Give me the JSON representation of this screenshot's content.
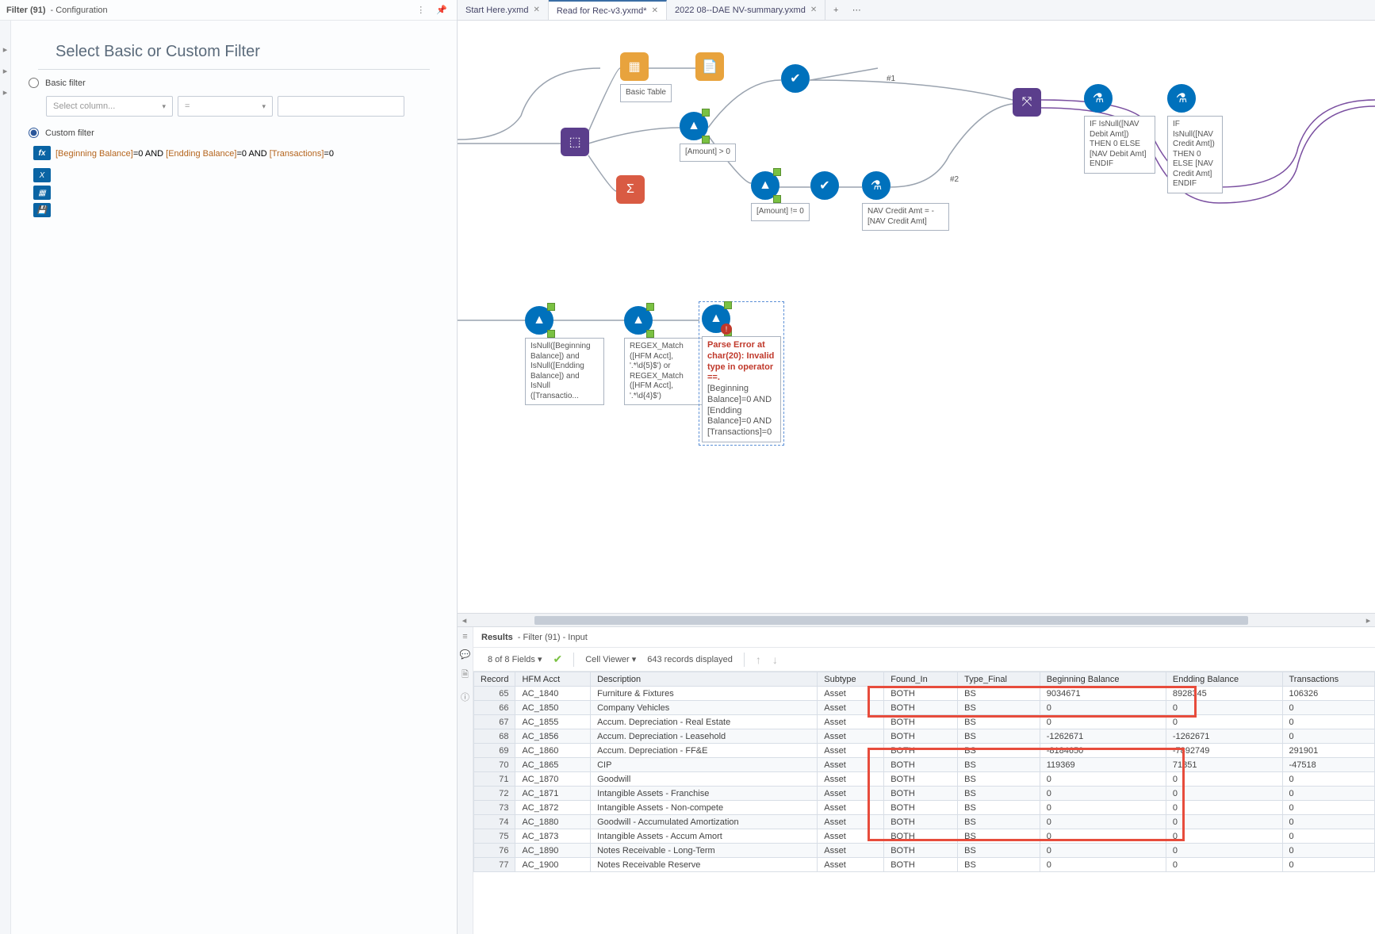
{
  "tabs": [
    {
      "label": "Start Here.yxmd"
    },
    {
      "label": "Read for Rec-v3.yxmd*"
    },
    {
      "label": "2022 08--DAE NV-summary.yxmd"
    }
  ],
  "config": {
    "header_title": "Filter (91)",
    "header_sub": "- Configuration",
    "panel_title": "Select Basic or Custom Filter",
    "basic_label": "Basic filter",
    "custom_label": "Custom filter",
    "select_column_ph": "Select column...",
    "operator_ph": "=",
    "expr_field1": "[Beginning Balance]",
    "expr_op1": "=",
    "expr_v1": "0 AND ",
    "expr_field2": "[Endding Balance]",
    "expr_v2": "=0 AND ",
    "expr_field3": "[Transactions]",
    "expr_v3": "=0"
  },
  "canvas": {
    "basic_table": "Basic Table",
    "amount_gt": "[Amount] > 0",
    "amount_ne": "[Amount] != 0",
    "nav_credit": "NAV Credit Amt = -[NAV Credit Amt]",
    "isnull_label": "IsNull([Beginning Balance]) and IsNull([Endding Balance]) and IsNull ([Transactio...",
    "regex_label": "REGEX_Match ([HFM Acct], '.*\\d{5}$') or REGEX_Match ([HFM Acct], '.*\\d{4}$')",
    "error_head": "Parse Error at char(20): Invalid type in operator ==.",
    "error_body": "[Beginning Balance]=0 AND [Endding Balance]=0 AND [Transactions]=0",
    "formula1": "IF IsNull([NAV Debit Amt]) THEN 0 ELSE [NAV Debit Amt] ENDIF",
    "formula2": "IF IsNull([NAV Credit Amt]) THEN 0 ELSE [NAV Credit Amt] ENDIF",
    "anno1": "#1",
    "anno2": "#2"
  },
  "results": {
    "header_title": "Results",
    "header_sub": "- Filter (91) - Input",
    "fields": "8 of 8 Fields",
    "cellviewer": "Cell Viewer",
    "records": "643 records displayed",
    "cols": [
      "Record",
      "HFM Acct",
      "Description",
      "Subtype",
      "Found_In",
      "Type_Final",
      "Beginning Balance",
      "Endding Balance",
      "Transactions"
    ],
    "rows": [
      [
        "65",
        "AC_1840",
        "Furniture & Fixtures",
        "Asset",
        "BOTH",
        "BS",
        "9034671",
        "8928345",
        "106326"
      ],
      [
        "66",
        "AC_1850",
        "Company Vehicles",
        "Asset",
        "BOTH",
        "BS",
        "0",
        "0",
        "0"
      ],
      [
        "67",
        "AC_1855",
        "Accum. Depreciation - Real Estate",
        "Asset",
        "BOTH",
        "BS",
        "0",
        "0",
        "0"
      ],
      [
        "68",
        "AC_1856",
        "Accum. Depreciation - Leasehold",
        "Asset",
        "BOTH",
        "BS",
        "-1262671",
        "-1262671",
        "0"
      ],
      [
        "69",
        "AC_1860",
        "Accum. Depreciation - FF&E",
        "Asset",
        "BOTH",
        "BS",
        "-8184650",
        "-7892749",
        "291901"
      ],
      [
        "70",
        "AC_1865",
        "CIP",
        "Asset",
        "BOTH",
        "BS",
        "119369",
        "71851",
        "-47518"
      ],
      [
        "71",
        "AC_1870",
        "Goodwill",
        "Asset",
        "BOTH",
        "BS",
        "0",
        "0",
        "0"
      ],
      [
        "72",
        "AC_1871",
        "Intangible Assets - Franchise",
        "Asset",
        "BOTH",
        "BS",
        "0",
        "0",
        "0"
      ],
      [
        "73",
        "AC_1872",
        "Intangible Assets - Non-compete",
        "Asset",
        "BOTH",
        "BS",
        "0",
        "0",
        "0"
      ],
      [
        "74",
        "AC_1880",
        "Goodwill - Accumulated Amortization",
        "Asset",
        "BOTH",
        "BS",
        "0",
        "0",
        "0"
      ],
      [
        "75",
        "AC_1873",
        "Intangible Assets - Accum Amort",
        "Asset",
        "BOTH",
        "BS",
        "0",
        "0",
        "0"
      ],
      [
        "76",
        "AC_1890",
        "Notes Receivable - Long-Term",
        "Asset",
        "BOTH",
        "BS",
        "0",
        "0",
        "0"
      ],
      [
        "77",
        "AC_1900",
        "Notes Receivable Reserve",
        "Asset",
        "BOTH",
        "BS",
        "0",
        "0",
        "0"
      ]
    ]
  }
}
